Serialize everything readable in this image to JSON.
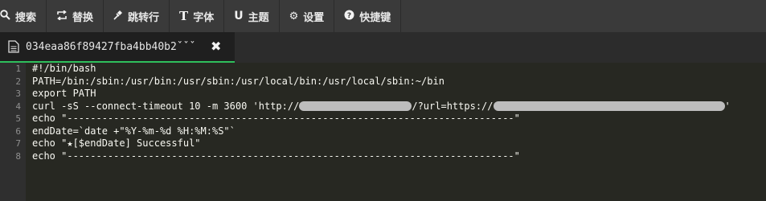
{
  "toolbar": {
    "items": [
      {
        "icon": "search-icon",
        "glyph": "🔍︎",
        "label": "搜索"
      },
      {
        "icon": "replace-icon",
        "glyph": "⇄",
        "label": "替换"
      },
      {
        "icon": "pin-icon",
        "glyph": "✎",
        "label": "跳转行"
      },
      {
        "icon": "text-icon",
        "glyph": "T",
        "label": "字体"
      },
      {
        "icon": "theme-icon",
        "glyph": "U",
        "label": "主题"
      },
      {
        "icon": "gear-icon",
        "glyph": "⚙",
        "label": "设置"
      },
      {
        "icon": "help-icon",
        "glyph": "❓",
        "label": "快捷键"
      }
    ]
  },
  "tab": {
    "title": "034eaa86f89427fba4bb40b2ˇˇˇ",
    "close": "✖",
    "accent": "#2fbf5c"
  },
  "editor": {
    "line_numbers": [
      "1",
      "2",
      "3",
      "4",
      "5",
      "6",
      "7",
      "8"
    ],
    "lines": [
      "#!/bin/bash",
      "PATH=/bin:/sbin:/usr/bin:/usr/sbin:/usr/local/bin:/usr/local/sbin:~/bin",
      "export PATH",
      "curl -sS --connect-timeout 10 -m 3600 'http://",
      "echo \"-----------------------------------------------------------------------------\"",
      "endDate=`date +\"%Y-%m-%d %H:%M:%S\"`",
      "echo \"★[$endDate] Successful\"",
      "echo \"-----------------------------------------------------------------------------\""
    ],
    "line4_mid": "/?url=https://",
    "line4_end": "'"
  }
}
